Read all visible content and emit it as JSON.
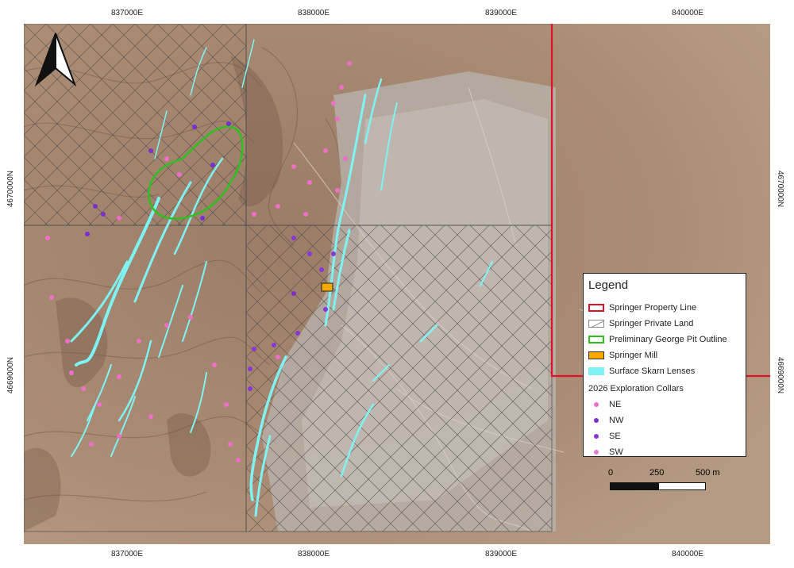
{
  "axes": {
    "top_ticks": [
      "837000E",
      "838000E",
      "839000E",
      "840000E"
    ],
    "bottom_ticks": [
      "837000E",
      "838000E",
      "839000E",
      "840000E"
    ],
    "left_ticks": [
      "4670000N",
      "4669000N"
    ],
    "right_ticks": [
      "4670000N",
      "4669000N"
    ]
  },
  "legend": {
    "title": "Legend",
    "items": [
      {
        "label": "Springer Property Line",
        "color": "#e0112b",
        "style": "outline"
      },
      {
        "label": "Springer Private Land",
        "color": "#888888",
        "style": "hatch"
      },
      {
        "label": "Preliminary George Pit Outline",
        "color": "#2fbf1f",
        "style": "outline"
      },
      {
        "label": "Springer Mill",
        "color": "#f5a800",
        "style": "fill"
      },
      {
        "label": "Surface Skarn Lenses",
        "color": "#7ff3f3",
        "style": "fill"
      }
    ],
    "collars_title": "2026 Exploration Collars",
    "collars": [
      {
        "label": "NE",
        "color": "#ef6fc8"
      },
      {
        "label": "NW",
        "color": "#7a2fd0"
      },
      {
        "label": "SE",
        "color": "#8a35d8"
      },
      {
        "label": "SW",
        "color": "#e27ad0"
      }
    ]
  },
  "scale_bar": {
    "labels": [
      "0",
      "250",
      "500 m"
    ]
  },
  "north_arrow": {
    "icon": "north-arrow-icon"
  },
  "colors": {
    "terrain": "#a8876d",
    "property_line": "#e0112b",
    "pit_outline": "#2fbf1f",
    "skarn": "#7ff3f3",
    "mill": "#f5a800"
  }
}
